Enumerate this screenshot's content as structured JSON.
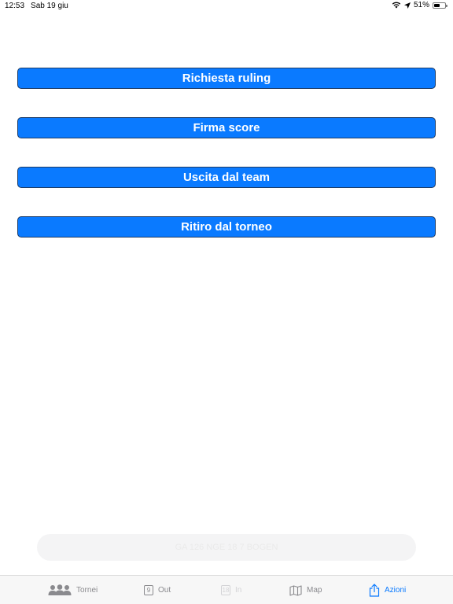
{
  "status_bar": {
    "time": "12:53",
    "date": "Sab 19 giu",
    "battery": "51%",
    "battery_level": 0.51
  },
  "actions": {
    "ruling": "Richiesta ruling",
    "sign_score": "Firma score",
    "leave_team": "Uscita dal team",
    "withdraw": "Ritiro dal torneo"
  },
  "faded_pill": {
    "text": "GA 126 NGE 18 7 BOGEN"
  },
  "tab_bar": {
    "tabs": [
      {
        "label": "Tornei",
        "icon": "people-icon",
        "state": "normal"
      },
      {
        "label": "Out",
        "icon": "hole-9-icon",
        "badge": "9",
        "state": "normal"
      },
      {
        "label": "In",
        "icon": "hole-18-icon",
        "badge": "18",
        "state": "disabled"
      },
      {
        "label": "Map",
        "icon": "map-icon",
        "state": "normal"
      },
      {
        "label": "Azioni",
        "icon": "share-icon",
        "state": "active"
      }
    ]
  },
  "colors": {
    "accent": "#0a7aff",
    "button_border": "#1c3b66",
    "inactive_tab": "#8a8a8e",
    "disabled_tab": "#d3d3d6"
  }
}
